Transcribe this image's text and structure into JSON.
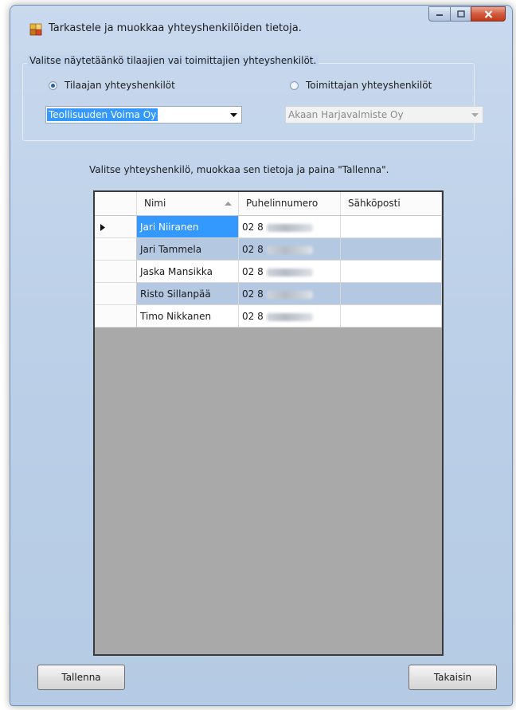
{
  "window": {
    "title": "Tarkastele ja muokkaa yhteyshenkilöiden tietoja."
  },
  "selection_group": {
    "legend": "Valitse näytetäänkö tilaajien vai toimittajien yhteyshenkilöt.",
    "customer_radio": {
      "label": "Tilaajan yhteyshenkilöt",
      "checked": true
    },
    "supplier_radio": {
      "label": "Toimittajan yhteyshenkilöt",
      "checked": false
    },
    "customer_combo": {
      "value": "Teollisuuden Voima Oy"
    },
    "supplier_combo": {
      "value": "Akaan Harjavalmiste Oy",
      "enabled": false
    }
  },
  "instruction": "Valitse yhteyshenkilö, muokkaa sen tietoja ja paina \"Tallenna\".",
  "grid": {
    "columns": [
      "Nimi",
      "Puhelinnumero",
      "Sähköposti"
    ],
    "sorted_column": "Nimi",
    "rows": [
      {
        "name": "Jari Niiranen",
        "phone": "02 8",
        "email": "",
        "current": true,
        "selected": true
      },
      {
        "name": "Jari Tammela",
        "phone": "02 8",
        "email": ""
      },
      {
        "name": "Jaska Mansikka",
        "phone": "02 8",
        "email": ""
      },
      {
        "name": "Risto Sillanpää",
        "phone": "02 8",
        "email": ""
      },
      {
        "name": "Timo Nikkanen",
        "phone": "02 8",
        "email": ""
      }
    ]
  },
  "buttons": {
    "save": "Tallenna",
    "back": "Takaisin"
  },
  "colors": {
    "selection": "#3399ff",
    "alt_row": "#b4c8e2",
    "grid_background": "#a9a9a9",
    "close_button": "#c23b1a"
  }
}
